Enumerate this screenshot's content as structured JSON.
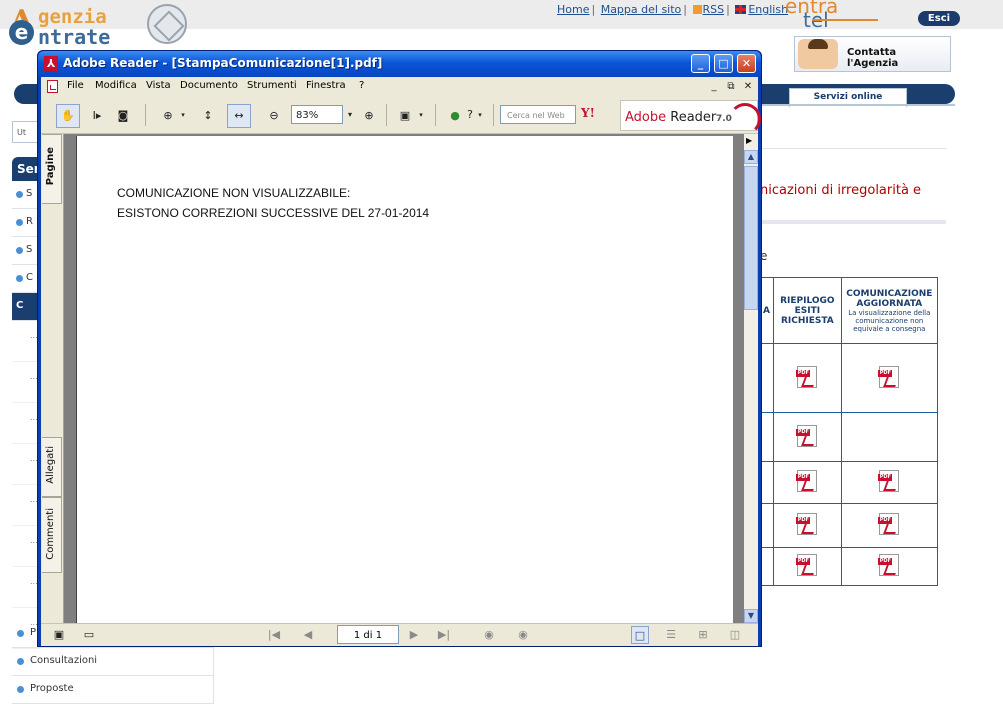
{
  "site": {
    "logo_line1": "genzia",
    "logo_line2": "ntrate",
    "logo_a": "A",
    "logo_e": "e",
    "links": {
      "home": "Home",
      "mappa": "Mappa del sito",
      "rss": "RSS",
      "english": "English"
    },
    "entratel_1": "entra",
    "entratel_2": "tel",
    "esci": "Esci",
    "contatta": "Contatta l'Agenzia",
    "servizi_tab": "Servizi online",
    "ut_box": "Ut",
    "menu_header": "Ser",
    "menu_items": [
      "S",
      "R",
      "S",
      "C",
      "C"
    ],
    "bottom_items": [
      "P",
      "Consultazioni",
      "Proposte"
    ],
    "red_title": "nicazioni di irregolarità e",
    "e_char": "e",
    "table": {
      "col_a_letter": "A",
      "col_riepilogo": "RIEPILOGO ESITI RICHIESTA",
      "col_comunicazione": "COMUNICAZIONE AGGIORNATA",
      "col_note": "La visualizzazione della comunicazione non equivale a consegna",
      "rows": [
        {
          "riepilogo_pdf": true,
          "comunicazione_pdf": true
        },
        {
          "riepilogo_pdf": true,
          "comunicazione_pdf": false
        },
        {
          "riepilogo_pdf": true,
          "comunicazione_pdf": true
        },
        {
          "riepilogo_pdf": true,
          "comunicazione_pdf": true
        },
        {
          "riepilogo_pdf": true,
          "comunicazione_pdf": true
        }
      ]
    },
    "colors": {
      "navy": "#1a3e6e",
      "orange": "#e08a2c",
      "red": "#b00000"
    }
  },
  "reader": {
    "title": "Adobe Reader - [StampaComunicazione[1].pdf]",
    "menu": [
      "File",
      "Modifica",
      "Vista",
      "Documento",
      "Strumenti",
      "Finestra",
      "?"
    ],
    "zoom": "83%",
    "help_label": "?",
    "search_placeholder": "Cerca nel Web",
    "brand": "Adobe",
    "brand_product": "Reader",
    "brand_version": "7.0",
    "side_tabs": [
      "Pagine",
      "Allegati",
      "Commenti"
    ],
    "document_lines": [
      "COMUNICAZIONE NON VISUALIZZABILE:",
      "ESISTONO CORREZIONI SUCCESSIVE DEL 27-01-2014"
    ],
    "page_indicator": "1 di 1",
    "colors": {
      "titlebar": "#0a56d8",
      "chrome": "#ece9d8",
      "brand_red": "#c8102e"
    }
  }
}
